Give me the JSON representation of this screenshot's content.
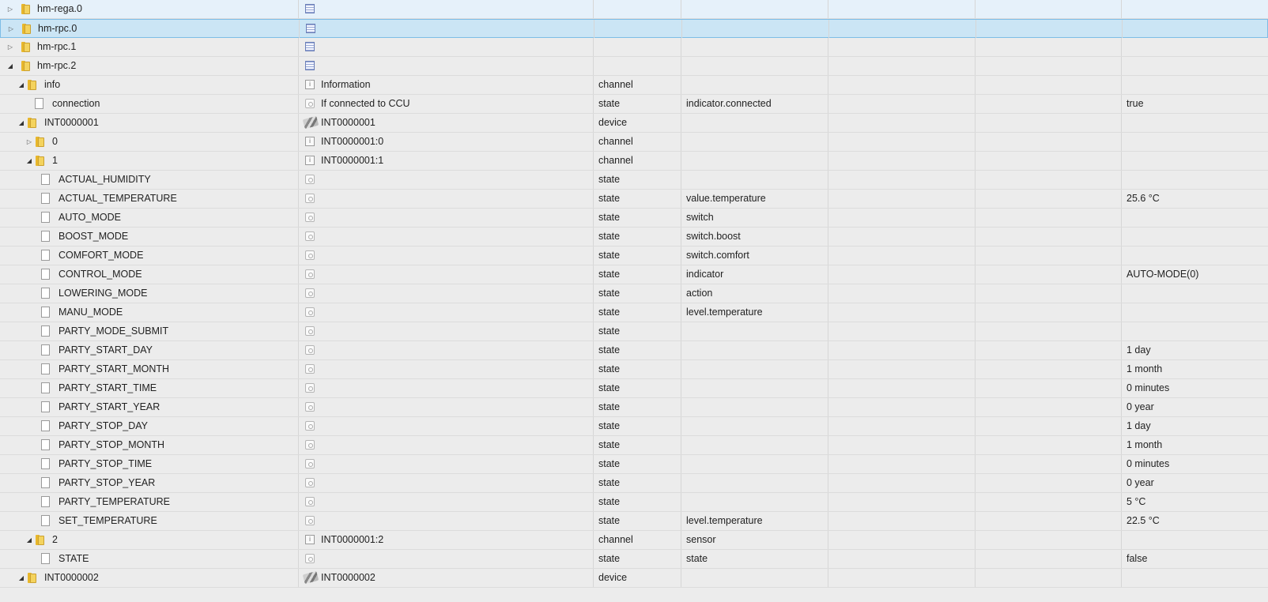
{
  "rows": [
    {
      "name": "hm-rega.0",
      "depth": 0,
      "kind": "folder",
      "expand": "closed",
      "icon": "adapter-icon",
      "label": "",
      "type": "",
      "role": "",
      "value": "",
      "variant": "top"
    },
    {
      "name": "hm-rpc.0",
      "depth": 0,
      "kind": "folder",
      "expand": "closed",
      "icon": "adapter-icon",
      "label": "",
      "type": "",
      "role": "",
      "value": "",
      "variant": "selected"
    },
    {
      "name": "hm-rpc.1",
      "depth": 0,
      "kind": "folder",
      "expand": "closed",
      "icon": "adapter-icon",
      "label": "",
      "type": "",
      "role": "",
      "value": ""
    },
    {
      "name": "hm-rpc.2",
      "depth": 0,
      "kind": "folder",
      "expand": "open",
      "icon": "adapter-icon",
      "label": "",
      "type": "",
      "role": "",
      "value": ""
    },
    {
      "name": "info",
      "depth": 1,
      "kind": "folder",
      "expand": "open",
      "icon": "channel-icon",
      "label": "Information",
      "type": "channel",
      "role": "",
      "value": ""
    },
    {
      "name": "connection",
      "depth": 2,
      "kind": "file",
      "expand": "none",
      "icon": "state-icon",
      "label": "If connected to CCU",
      "type": "state",
      "role": "indicator.connected",
      "value": "true"
    },
    {
      "name": "INT0000001",
      "depth": 1,
      "kind": "folder",
      "expand": "open",
      "icon": "device-icon",
      "label": "INT0000001",
      "type": "device",
      "role": "",
      "value": ""
    },
    {
      "name": "0",
      "depth": 2,
      "kind": "folder",
      "expand": "closed",
      "icon": "channel-icon",
      "label": "INT0000001:0",
      "type": "channel",
      "role": "",
      "value": ""
    },
    {
      "name": "1",
      "depth": 2,
      "kind": "folder",
      "expand": "open",
      "icon": "channel-icon",
      "label": "INT0000001:1",
      "type": "channel",
      "role": "",
      "value": ""
    },
    {
      "name": "ACTUAL_HUMIDITY",
      "depth": 3,
      "kind": "file",
      "expand": "none",
      "icon": "state-icon",
      "label": "",
      "type": "state",
      "role": "",
      "value": ""
    },
    {
      "name": "ACTUAL_TEMPERATURE",
      "depth": 3,
      "kind": "file",
      "expand": "none",
      "icon": "state-icon",
      "label": "",
      "type": "state",
      "role": "value.temperature",
      "value": "25.6 °C"
    },
    {
      "name": "AUTO_MODE",
      "depth": 3,
      "kind": "file",
      "expand": "none",
      "icon": "state-icon",
      "label": "",
      "type": "state",
      "role": "switch",
      "value": ""
    },
    {
      "name": "BOOST_MODE",
      "depth": 3,
      "kind": "file",
      "expand": "none",
      "icon": "state-icon",
      "label": "",
      "type": "state",
      "role": "switch.boost",
      "value": ""
    },
    {
      "name": "COMFORT_MODE",
      "depth": 3,
      "kind": "file",
      "expand": "none",
      "icon": "state-icon",
      "label": "",
      "type": "state",
      "role": "switch.comfort",
      "value": ""
    },
    {
      "name": "CONTROL_MODE",
      "depth": 3,
      "kind": "file",
      "expand": "none",
      "icon": "state-icon",
      "label": "",
      "type": "state",
      "role": "indicator",
      "value": "AUTO-MODE(0)"
    },
    {
      "name": "LOWERING_MODE",
      "depth": 3,
      "kind": "file",
      "expand": "none",
      "icon": "state-icon",
      "label": "",
      "type": "state",
      "role": "action",
      "value": ""
    },
    {
      "name": "MANU_MODE",
      "depth": 3,
      "kind": "file",
      "expand": "none",
      "icon": "state-icon",
      "label": "",
      "type": "state",
      "role": "level.temperature",
      "value": ""
    },
    {
      "name": "PARTY_MODE_SUBMIT",
      "depth": 3,
      "kind": "file",
      "expand": "none",
      "icon": "state-icon",
      "label": "",
      "type": "state",
      "role": "",
      "value": ""
    },
    {
      "name": "PARTY_START_DAY",
      "depth": 3,
      "kind": "file",
      "expand": "none",
      "icon": "state-icon",
      "label": "",
      "type": "state",
      "role": "",
      "value": "1 day"
    },
    {
      "name": "PARTY_START_MONTH",
      "depth": 3,
      "kind": "file",
      "expand": "none",
      "icon": "state-icon",
      "label": "",
      "type": "state",
      "role": "",
      "value": "1 month"
    },
    {
      "name": "PARTY_START_TIME",
      "depth": 3,
      "kind": "file",
      "expand": "none",
      "icon": "state-icon",
      "label": "",
      "type": "state",
      "role": "",
      "value": "0 minutes"
    },
    {
      "name": "PARTY_START_YEAR",
      "depth": 3,
      "kind": "file",
      "expand": "none",
      "icon": "state-icon",
      "label": "",
      "type": "state",
      "role": "",
      "value": "0 year"
    },
    {
      "name": "PARTY_STOP_DAY",
      "depth": 3,
      "kind": "file",
      "expand": "none",
      "icon": "state-icon",
      "label": "",
      "type": "state",
      "role": "",
      "value": "1 day"
    },
    {
      "name": "PARTY_STOP_MONTH",
      "depth": 3,
      "kind": "file",
      "expand": "none",
      "icon": "state-icon",
      "label": "",
      "type": "state",
      "role": "",
      "value": "1 month"
    },
    {
      "name": "PARTY_STOP_TIME",
      "depth": 3,
      "kind": "file",
      "expand": "none",
      "icon": "state-icon",
      "label": "",
      "type": "state",
      "role": "",
      "value": "0 minutes"
    },
    {
      "name": "PARTY_STOP_YEAR",
      "depth": 3,
      "kind": "file",
      "expand": "none",
      "icon": "state-icon",
      "label": "",
      "type": "state",
      "role": "",
      "value": "0 year"
    },
    {
      "name": "PARTY_TEMPERATURE",
      "depth": 3,
      "kind": "file",
      "expand": "none",
      "icon": "state-icon",
      "label": "",
      "type": "state",
      "role": "",
      "value": "5 °C"
    },
    {
      "name": "SET_TEMPERATURE",
      "depth": 3,
      "kind": "file",
      "expand": "none",
      "icon": "state-icon",
      "label": "",
      "type": "state",
      "role": "level.temperature",
      "value": "22.5 °C"
    },
    {
      "name": "2",
      "depth": 2,
      "kind": "folder",
      "expand": "open",
      "icon": "channel-icon",
      "label": "INT0000001:2",
      "type": "channel",
      "role": "sensor",
      "value": ""
    },
    {
      "name": "STATE",
      "depth": 3,
      "kind": "file",
      "expand": "none",
      "icon": "state-icon",
      "label": "",
      "type": "state",
      "role": "state",
      "value": "false"
    },
    {
      "name": "INT0000002",
      "depth": 1,
      "kind": "folder",
      "expand": "open",
      "icon": "device-icon",
      "label": "INT0000002",
      "type": "device",
      "role": "",
      "value": ""
    }
  ]
}
